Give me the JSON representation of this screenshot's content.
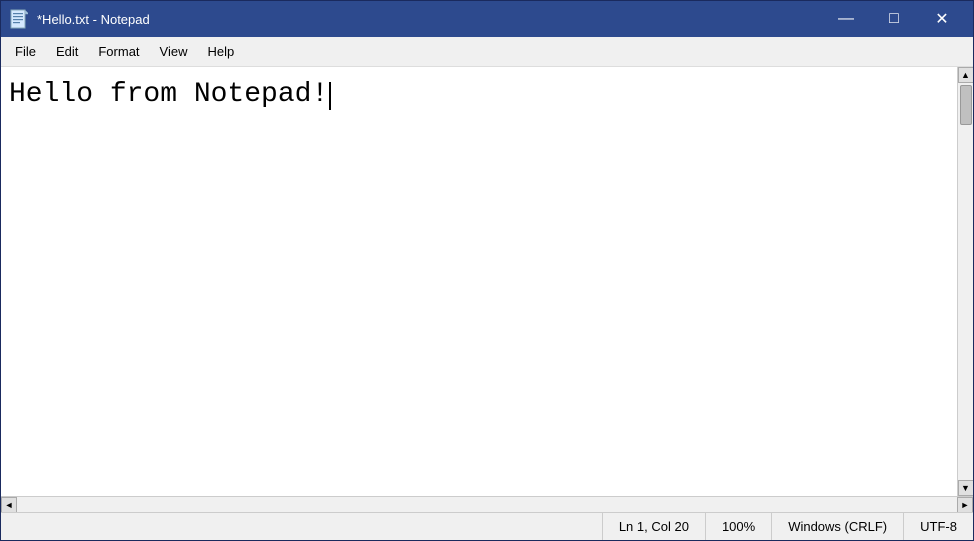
{
  "window": {
    "title": "*Hello.txt - Notepad",
    "icon": "notepad-icon"
  },
  "title_controls": {
    "minimize": "—",
    "maximize": "□",
    "close": "✕"
  },
  "menu": {
    "items": [
      {
        "id": "file",
        "label": "File"
      },
      {
        "id": "edit",
        "label": "Edit"
      },
      {
        "id": "format",
        "label": "Format"
      },
      {
        "id": "view",
        "label": "View"
      },
      {
        "id": "help",
        "label": "Help"
      }
    ]
  },
  "editor": {
    "content": "Hello from Notepad!"
  },
  "status_bar": {
    "position": "Ln 1, Col 20",
    "zoom": "100%",
    "line_ending": "Windows (CRLF)",
    "encoding": "UTF-8"
  }
}
